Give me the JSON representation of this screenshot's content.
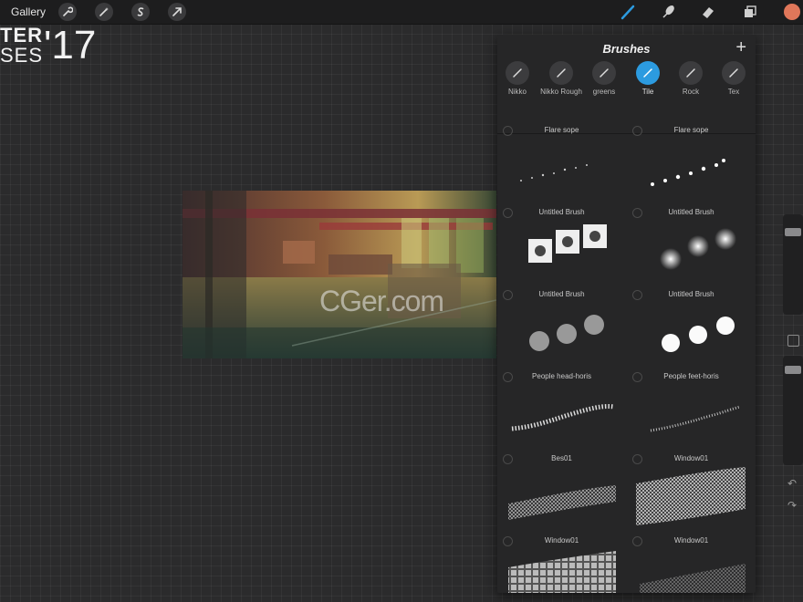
{
  "topbar": {
    "gallery_label": "Gallery",
    "left_tools": [
      "wrench-icon",
      "magic-wand-icon",
      "selection-icon",
      "transform-arrow-icon"
    ],
    "right_tools": [
      "brush-icon",
      "smudge-icon",
      "eraser-icon",
      "layers-icon"
    ],
    "current_color": "#e0775a"
  },
  "canvas": {
    "poster_line1": "TER",
    "poster_line2": "SES",
    "poster_year": "'17",
    "watermark": "CGer.com"
  },
  "brushes_panel": {
    "title": "Brushes",
    "add_label": "+",
    "accent_color": "#2c9be0",
    "sets": [
      {
        "label": "Nikko",
        "active": false
      },
      {
        "label": "Nikko Rough",
        "active": false
      },
      {
        "label": "greens",
        "active": false
      },
      {
        "label": "Tile",
        "active": true
      },
      {
        "label": "Rock",
        "active": false
      },
      {
        "label": "Tex",
        "active": false
      }
    ],
    "brushes": [
      {
        "name": "Flare sope"
      },
      {
        "name": "Flare sope"
      },
      {
        "name": "Untitled Brush"
      },
      {
        "name": "Untitled Brush"
      },
      {
        "name": "Untitled Brush"
      },
      {
        "name": "Untitled Brush"
      },
      {
        "name": "People head-horis"
      },
      {
        "name": "People feet-horis"
      },
      {
        "name": "Bes01"
      },
      {
        "name": "Window01"
      },
      {
        "name": "Window01"
      },
      {
        "name": "Window01"
      }
    ]
  },
  "sidebar": {
    "size_slider": 0.15,
    "opacity_slider": 0.1,
    "undo_label": "↶",
    "redo_label": "↷"
  }
}
